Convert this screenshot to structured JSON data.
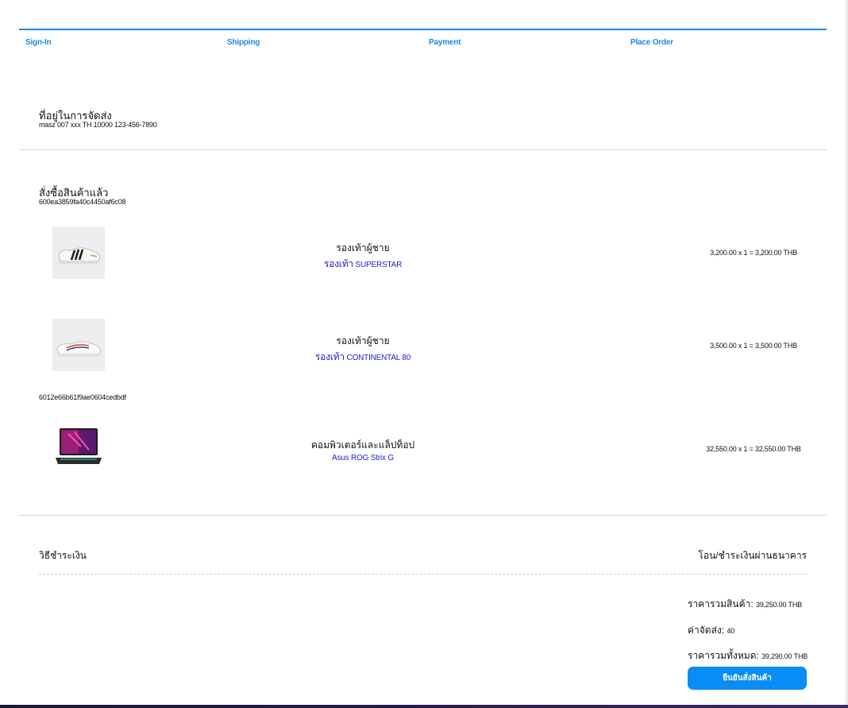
{
  "steps": [
    "Sign-In",
    "Shipping",
    "Payment",
    "Place Order"
  ],
  "shipping": {
    "title": "ที่อยู่ในการจัดส่ง",
    "address": "masz 007 xxx TH 10000 123-456-7890"
  },
  "order": {
    "title": "สั่งซื้อสินค้าแล้ว",
    "groups": [
      {
        "id": "600ea3859fa40c4450af6c08",
        "items": [
          {
            "category": "รองเท้าผู้ชาย",
            "name_prefix": "รองเท้า",
            "name": "SUPERSTAR",
            "price_line": "3,200.00 x 1 = 3,200.00 THB",
            "thumb_icon": "sneaker-superstar-image"
          },
          {
            "category": "รองเท้าผู้ชาย",
            "name_prefix": "รองเท้า",
            "name": "CONTINENTAL 80",
            "price_line": "3,500.00 x 1 = 3,500.00 THB",
            "thumb_icon": "sneaker-continental-image"
          }
        ]
      },
      {
        "id": "6012e66b61f9ae0604cedbdf",
        "items": [
          {
            "category": "คอมพิวเตอร์และแล็ปท็อป",
            "name_prefix": "",
            "name": "Asus ROG Strix G",
            "price_line": "32,550.00 x 1 = 32,550.00 THB",
            "thumb_icon": "laptop-image"
          }
        ]
      }
    ]
  },
  "payment": {
    "label": "วิธีชำระเงิน",
    "method": "โอน/ชำระเงินผ่านธนาคาร"
  },
  "summary": {
    "subtotal_label": "ราคารวมสินค้า:",
    "subtotal_value": "39,250.00 THB",
    "shipping_label": "ค่าจัดส่ง:",
    "shipping_value": "40",
    "total_label": "ราคารวมทั้งหมด:",
    "total_value": "39,290.00 THB"
  },
  "confirm_label": "ยืนยันสั่งสินค้า",
  "colors": {
    "accent": "#1e88e5",
    "button": "#0a8cf5",
    "item_name": "#2222cc"
  }
}
